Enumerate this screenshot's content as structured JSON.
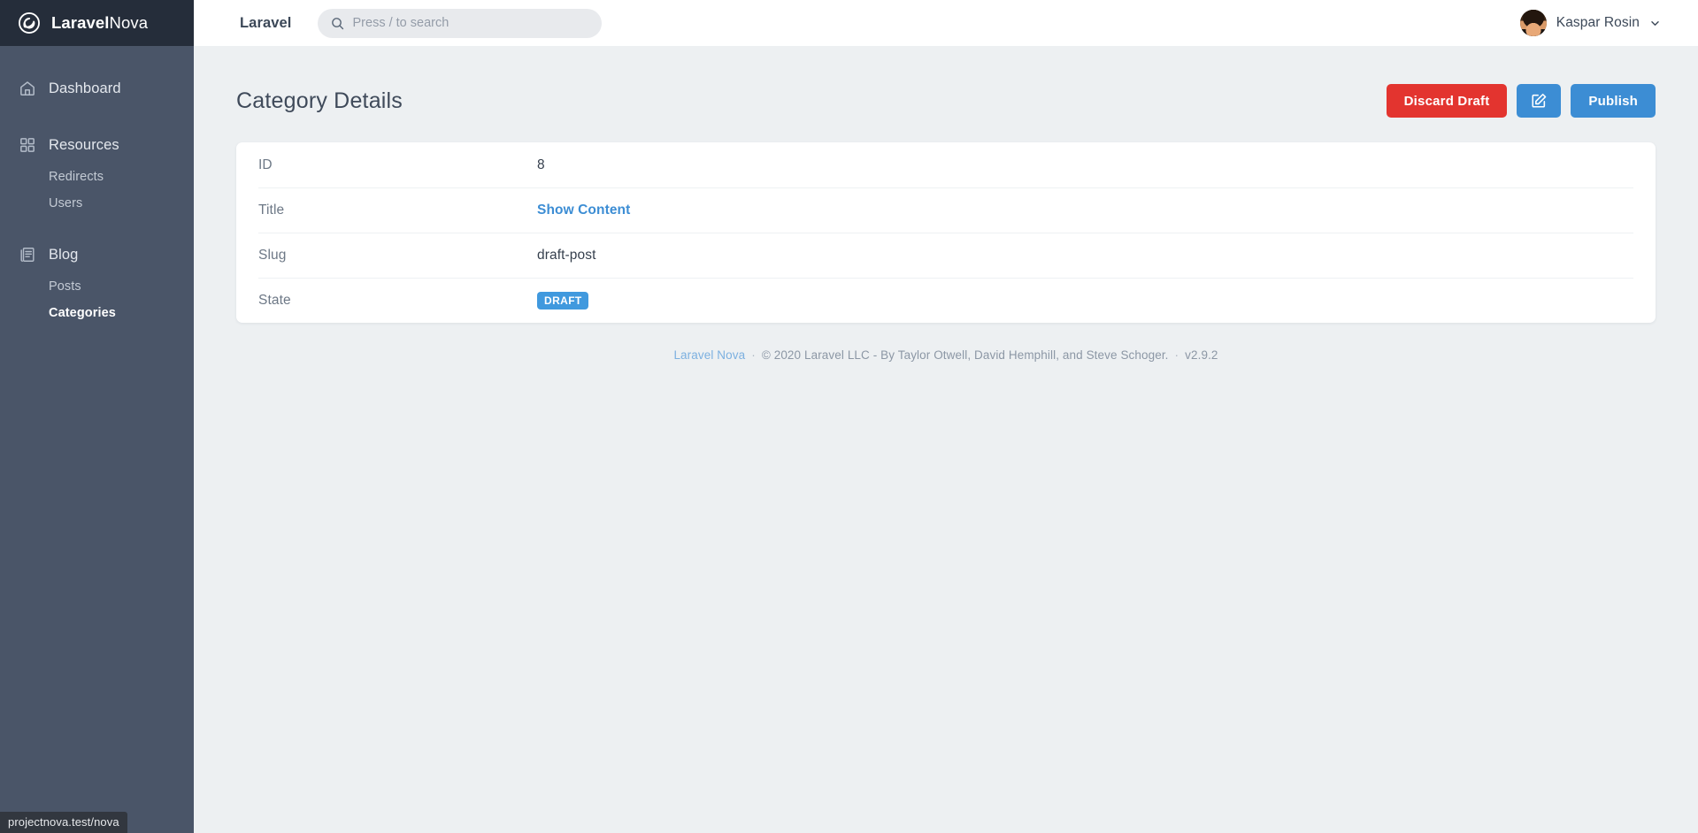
{
  "sidebar": {
    "logo": {
      "icon": "nova-spiral-logo-icon",
      "brand_bold": "Laravel",
      "brand_light": "Nova"
    },
    "groups": [
      {
        "icon": "home-icon",
        "label": "Dashboard",
        "active": false,
        "children": []
      },
      {
        "icon": "grid-icon",
        "label": "Resources",
        "active": false,
        "children": [
          {
            "label": "Redirects",
            "active": false
          },
          {
            "label": "Users",
            "active": false
          }
        ]
      },
      {
        "icon": "document-list-icon",
        "label": "Blog",
        "active": false,
        "children": [
          {
            "label": "Posts",
            "active": false
          },
          {
            "label": "Categories",
            "active": true
          }
        ]
      }
    ]
  },
  "topbar": {
    "brand": "Laravel",
    "search": {
      "icon": "search-icon",
      "placeholder": "Press / to search",
      "value": ""
    },
    "user": {
      "name": "Kaspar Rosin",
      "avatar": "user-avatar",
      "chevron": "chevron-down-icon"
    }
  },
  "page": {
    "title": "Category Details",
    "actions": {
      "discard_label": "Discard Draft",
      "edit_icon": "edit-pencil-square-icon",
      "publish_label": "Publish"
    }
  },
  "detail": {
    "rows": [
      {
        "label": "ID",
        "value": "8",
        "type": "text"
      },
      {
        "label": "Title",
        "value": "Show Content",
        "type": "link"
      },
      {
        "label": "Slug",
        "value": "draft-post",
        "type": "text"
      },
      {
        "label": "State",
        "value": "DRAFT",
        "type": "badge"
      }
    ]
  },
  "footer": {
    "link_label": "Laravel Nova",
    "separator_1": "·",
    "copyright": "© 2020 Laravel LLC - By Taylor Otwell, David Hemphill, and Steve Schoger.",
    "separator_2": "·",
    "version": "v2.9.2"
  },
  "status_bar": {
    "url": "projectnova.test/nova"
  },
  "colors": {
    "sidebar_bg": "#4a5568",
    "sidebar_logo_bg": "#252d3a",
    "page_bg": "#edf0f2",
    "accent_blue": "#3c8dd4",
    "danger_red": "#e3342f",
    "badge_blue": "#4099de"
  }
}
